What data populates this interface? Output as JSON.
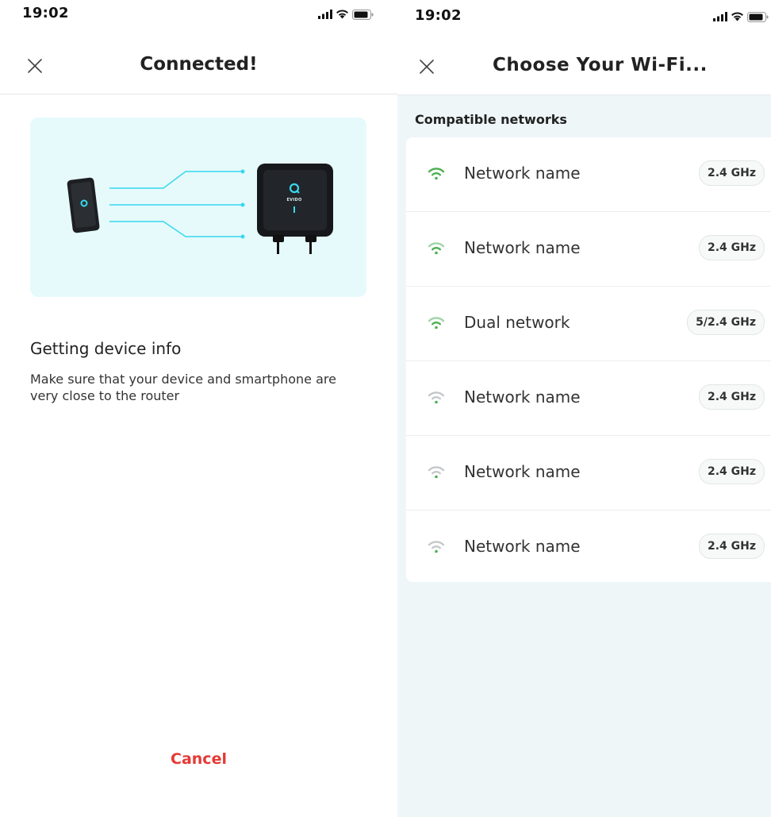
{
  "left": {
    "status": {
      "time": "19:02"
    },
    "nav": {
      "title": "Connected!"
    },
    "hero": {
      "device_brand": "EVIDO"
    },
    "info": {
      "title": "Getting device info",
      "description": "Make sure that your device and smartphone are very close to the router"
    },
    "cancel_label": "Cancel"
  },
  "right": {
    "status": {
      "time": "19:02"
    },
    "nav": {
      "title": "Choose Your Wi-Fi..."
    },
    "section_label": "Compatible networks",
    "networks": [
      {
        "name": "Network name",
        "band": "2.4 GHz",
        "signal": "strong"
      },
      {
        "name": "Network name",
        "band": "2.4 GHz",
        "signal": "medium"
      },
      {
        "name": "Dual network",
        "band": "5/2.4 GHz",
        "signal": "medium"
      },
      {
        "name": "Network name",
        "band": "2.4 GHz",
        "signal": "weak"
      },
      {
        "name": "Network name",
        "band": "2.4 GHz",
        "signal": "weak"
      },
      {
        "name": "Network name",
        "band": "2.4 GHz",
        "signal": "weak"
      }
    ]
  },
  "icons": {
    "signal": "cellular-signal-icon",
    "wifi": "wifi-icon",
    "battery": "battery-icon",
    "close": "close-icon"
  },
  "colors": {
    "accent_red": "#e53935",
    "wifi_strong": "#4caf50",
    "wifi_medium": "#7cc38a",
    "wifi_weak": "#c4c8ca",
    "hero_bg": "#e6fafc",
    "cyan_line": "#33d6ec"
  }
}
